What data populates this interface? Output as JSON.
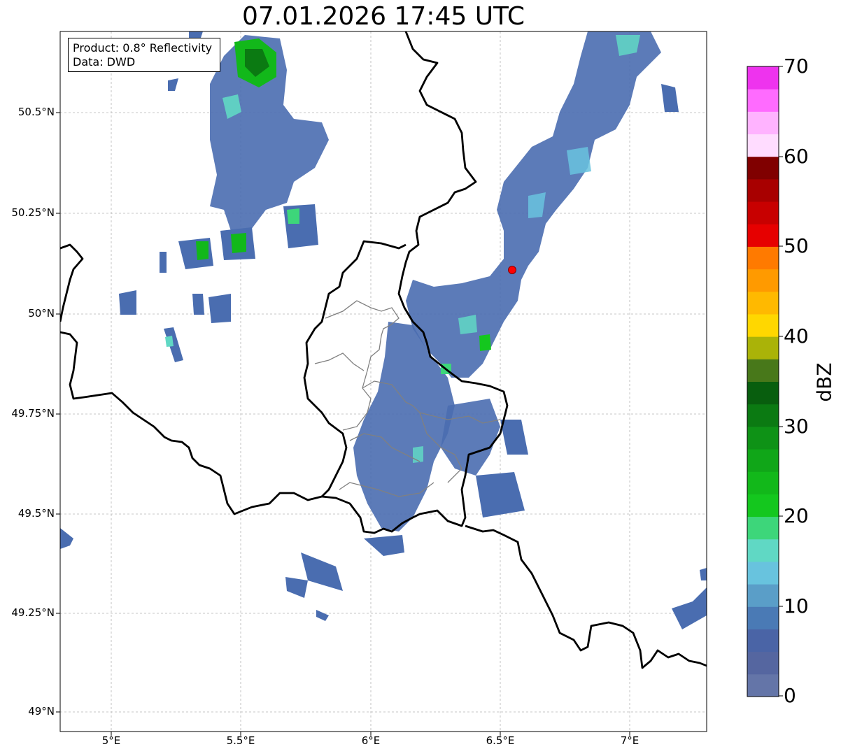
{
  "title": "07.01.2026 17:45 UTC",
  "info": {
    "product": "Product: 0.8° Reflectivity",
    "data_source": "Data: DWD"
  },
  "lat_labels": [
    "50.5°N",
    "50.25°N",
    "50°N",
    "49.75°N",
    "49.5°N",
    "49.25°N",
    "49°N"
  ],
  "lon_labels": [
    "5°E",
    "5.5°E",
    "6°E",
    "6.5°E",
    "7°E"
  ],
  "colorbar": {
    "label": "dBZ",
    "ticks": [
      "0",
      "10",
      "20",
      "30",
      "40",
      "50",
      "60",
      "70"
    ],
    "colors": [
      "#6475a8",
      "#5566a0",
      "#4a64a6",
      "#4a7ab5",
      "#5a9ec8",
      "#68c3de",
      "#60d8c4",
      "#3dd67a",
      "#14c71e",
      "#12b81a",
      "#10a618",
      "#0e9216",
      "#0b7a12",
      "#085e0e",
      "#48781a",
      "#aab308",
      "#ffd700",
      "#ffb900",
      "#ff9a00",
      "#ff7a00",
      "#e60000",
      "#c80000",
      "#a80000",
      "#800000",
      "#ffdcff",
      "#ffb3ff",
      "#ff6bff",
      "#ee33ee"
    ]
  },
  "map": {
    "extent_lon": [
      4.8,
      7.3
    ],
    "extent_lat": [
      48.95,
      50.7
    ],
    "radar_site_color": "#ff0000",
    "border_color": "#000000",
    "admin_border_color": "#808080"
  }
}
